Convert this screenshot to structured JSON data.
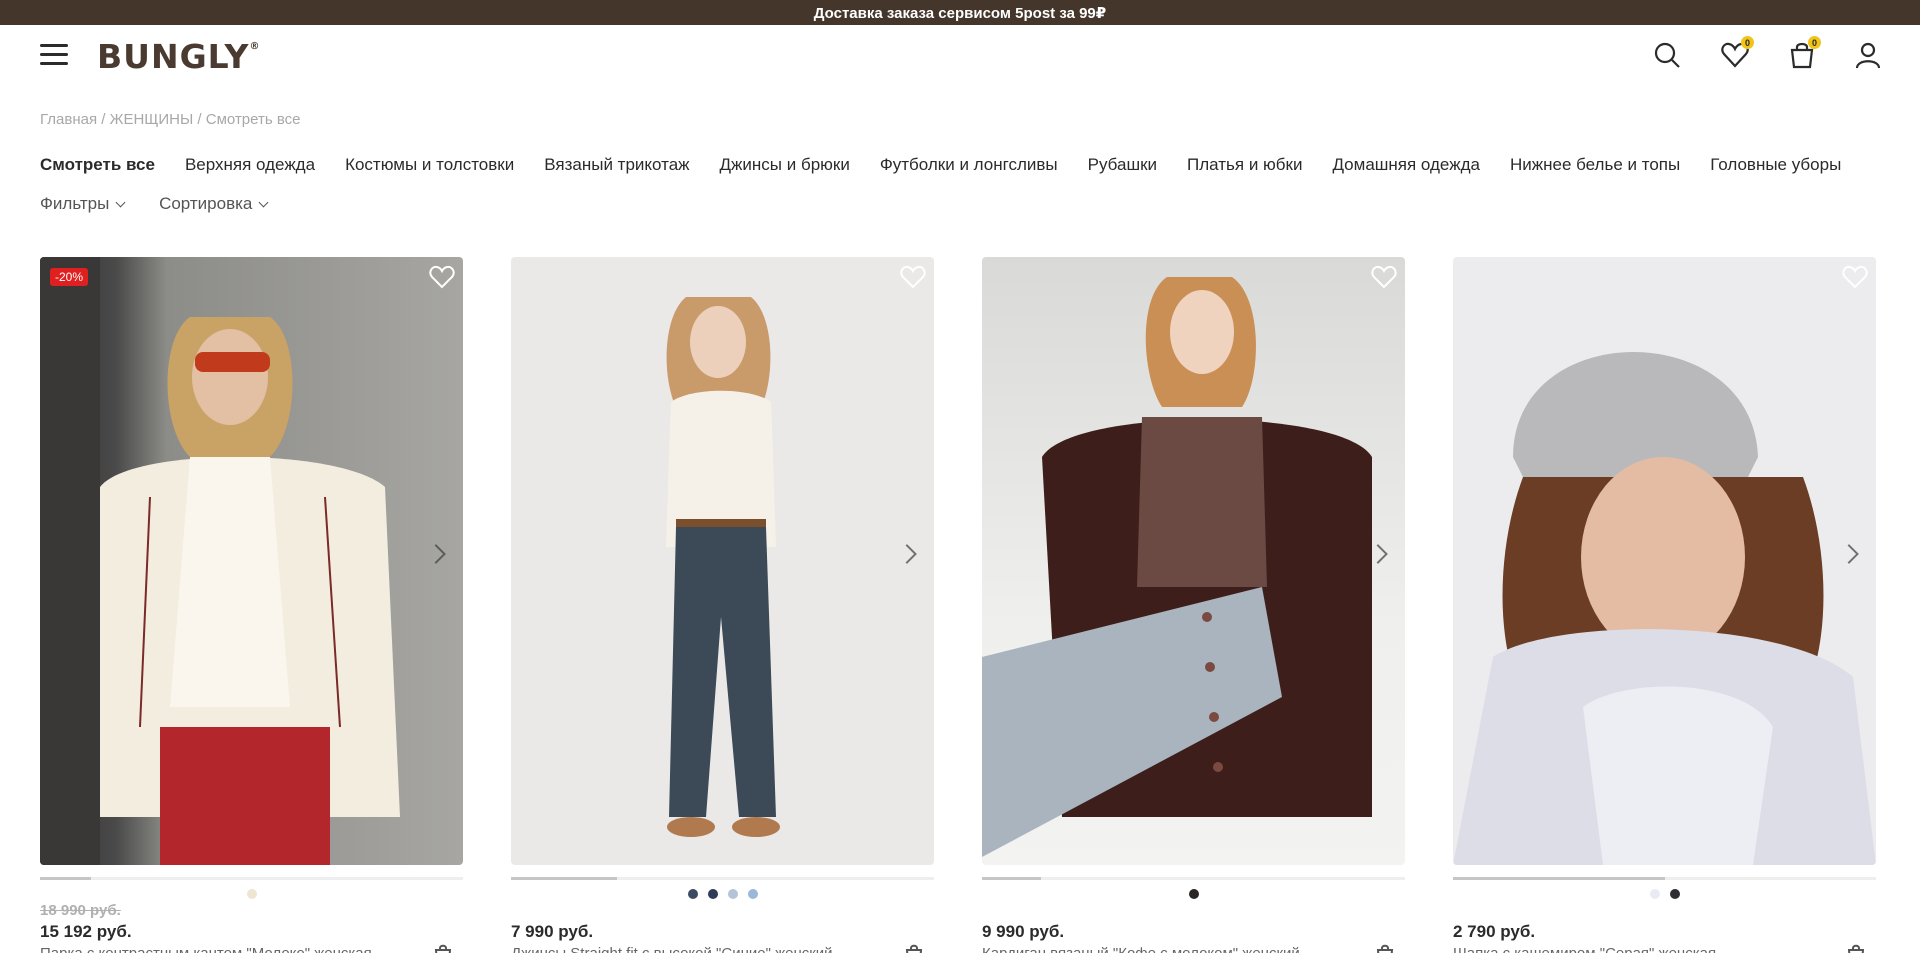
{
  "promo": {
    "text": "Доставка заказа сервисом 5post за 99₽"
  },
  "header": {
    "logo": "BUNGLY",
    "logo_mark": "®",
    "icons": [
      "search-icon",
      "heart-icon",
      "bag-icon",
      "user-icon"
    ],
    "favorites_count": "0",
    "cart_count": "0"
  },
  "breadcrumb": {
    "items": [
      "Главная",
      "ЖЕНЩИНЫ",
      "Смотреть все"
    ],
    "separator": " / "
  },
  "categories": [
    "Смотреть все",
    "Верхняя одежда",
    "Костюмы и толстовки",
    "Вязаный трикотаж",
    "Джинсы и брюки",
    "Футболки и лонгсливы",
    "Рубашки",
    "Платья и юбки",
    "Домашняя одежда",
    "Нижнее белье и топы",
    "Головные уборы"
  ],
  "controls": {
    "filters": "Фильтры",
    "sort": "Сортировка"
  },
  "colors": {
    "promo_bg": "#45362b",
    "badge": "#f0c419",
    "discount": "#e02020"
  },
  "products": [
    {
      "badge": "-20%",
      "old_price": "18 990 руб.",
      "price": "15 192 руб.",
      "name": "Парка с контрастным кантом \"Молоко\" женская",
      "progress": 0.12,
      "swatches": [
        "#efe6d2"
      ]
    },
    {
      "badge": "",
      "old_price": "",
      "price": "7 990 руб.",
      "name": "Джинсы Straight fit с высокой \"Синие\" женский",
      "progress": 0.25,
      "swatches": [
        "#3d4a63",
        "#2f3b57",
        "#b5c3d6",
        "#9bb8d9"
      ]
    },
    {
      "badge": "",
      "old_price": "",
      "price": "9 990 руб.",
      "name": "Кардиган вязаный \"Кофе с молоком\" женский",
      "progress": 0.14,
      "swatches": [
        "#2b2523"
      ]
    },
    {
      "badge": "",
      "old_price": "",
      "price": "2 790 руб.",
      "name": "Шапка с кашемиром \"Серая\" женская",
      "progress": 0.5,
      "swatches": [
        "#e8ebf3",
        "#2f2f33"
      ]
    }
  ]
}
